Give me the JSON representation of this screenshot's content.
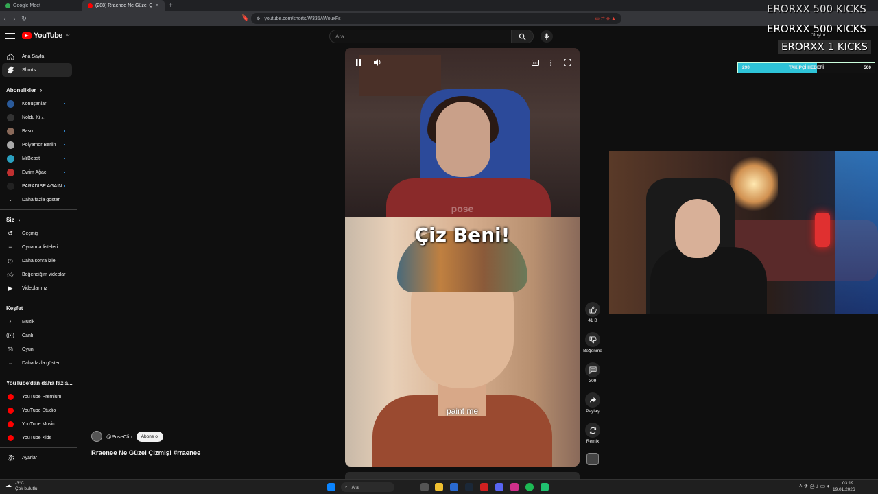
{
  "browser": {
    "tabs": [
      {
        "title": "Google Meet",
        "color": "#34a853"
      },
      {
        "title": "(288) Rraenee Ne Güzel Çizmi",
        "color": "#ff0000"
      }
    ],
    "new_tab": "+",
    "url": "youtube.com/shorts/W335AWouxFs"
  },
  "header": {
    "brand": "YouTube",
    "brand_sup": "TR",
    "search_placeholder": "Ara"
  },
  "sidebar": {
    "main": [
      {
        "label": "Ana Sayfa",
        "icon": "home-icon"
      },
      {
        "label": "Shorts",
        "icon": "shorts-icon"
      }
    ],
    "subs_heading": "Abonelikler",
    "subs": [
      {
        "label": "Konuşanlar",
        "color": "#2a5a9a"
      },
      {
        "label": "Noldu Ki ¿",
        "color": "#333"
      },
      {
        "label": "Baso",
        "color": "#8a6a5a"
      },
      {
        "label": "Polyamor Berlin",
        "color": "#aaa"
      },
      {
        "label": "MrBeast",
        "color": "#2aa0c0"
      },
      {
        "label": "Evrim Ağacı",
        "color": "#c03030"
      },
      {
        "label": "PARADISE AGAIN",
        "color": "#222"
      }
    ],
    "subs_more": "Daha fazla göster",
    "you_heading": "Siz",
    "you": [
      {
        "label": "Geçmiş",
        "icon": "history-icon"
      },
      {
        "label": "Oynatma listeleri",
        "icon": "playlist-icon"
      },
      {
        "label": "Daha sonra izle",
        "icon": "clock-icon"
      },
      {
        "label": "Beğendiğim videolar",
        "icon": "like-icon"
      },
      {
        "label": "Videolarınız",
        "icon": "video-icon"
      }
    ],
    "explore_heading": "Keşfet",
    "explore": [
      {
        "label": "Müzik",
        "icon": "music-icon"
      },
      {
        "label": "Canlı",
        "icon": "live-icon"
      },
      {
        "label": "Oyun",
        "icon": "gaming-icon"
      }
    ],
    "explore_more": "Daha fazla göster",
    "more_heading": "YouTube'dan daha fazla...",
    "more": [
      {
        "label": "YouTube Premium"
      },
      {
        "label": "YouTube Studio"
      },
      {
        "label": "YouTube Music"
      },
      {
        "label": "YouTube Kids"
      }
    ],
    "settings": "Ayarlar"
  },
  "short": {
    "watermark": "pose",
    "caption_big": "Çiz Beni!",
    "caption_small": "paint me"
  },
  "actions": {
    "likes": "41 B",
    "dislike": "Beğenme",
    "comments": "309",
    "share": "Paylaş",
    "remix": "Remix"
  },
  "channel": {
    "handle": "@PoseClip",
    "subscribe": "Abone ol",
    "title": "Rraenee Ne Güzel Çizmiş! #rraenee"
  },
  "overlay": {
    "line1": "ERORXX  500 KICKS",
    "line2": "ERORXX  500 KICKS",
    "line3": "ERORXX  1 KICKS",
    "goal_current": "290",
    "goal_label": "TAKİPÇİ HEDEFİ",
    "goal_target": "500",
    "goal_progress": 0.58,
    "create": "Oluştur"
  },
  "taskbar": {
    "weather_temp": "-3°C",
    "weather_text": "Çok bulutlu",
    "search_placeholder": "Ara",
    "time": "03:19",
    "date": "19.01.2026"
  }
}
